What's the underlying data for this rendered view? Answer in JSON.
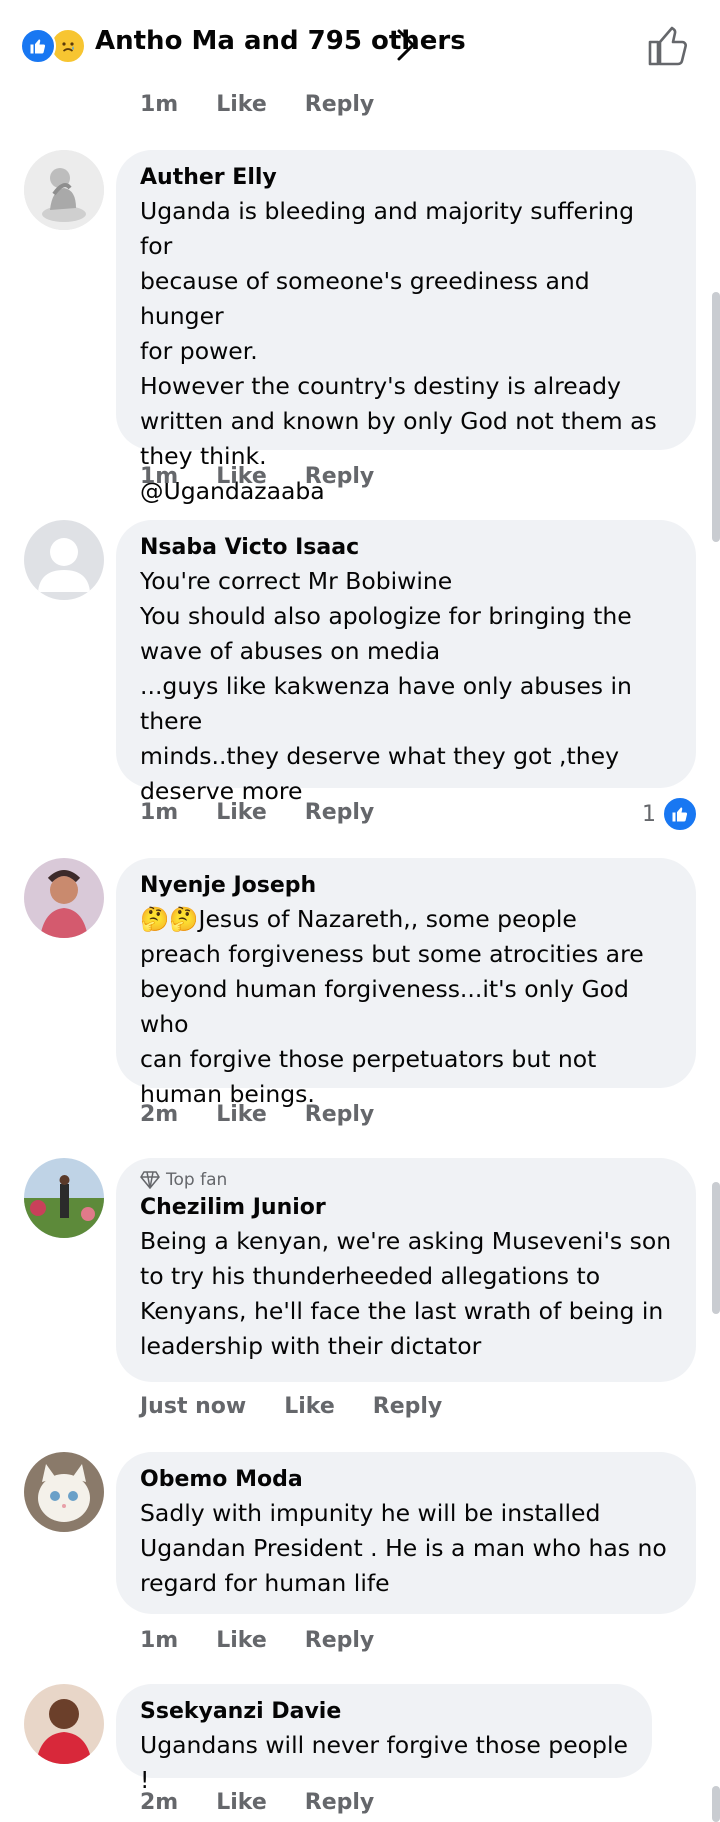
{
  "header": {
    "reactions": [
      "like",
      "sad"
    ],
    "names": "Antho Ma and 795 others"
  },
  "top_actions": {
    "time": "1m",
    "like": "Like",
    "reply": "Reply"
  },
  "comments": [
    {
      "name": "Auther Elly",
      "text": "Uganda is bleeding and majority suffering for\nbecause of someone's greediness and hunger\nfor power.\nHowever the country's destiny is already\nwritten and known by only God not them as\nthey think.\n@Ugandazaaba",
      "time": "1m",
      "like": "Like",
      "reply": "Reply"
    },
    {
      "name": "Nsaba Victo Isaac",
      "text": "You're correct Mr Bobiwine\nYou should also apologize for bringing the\nwave of abuses on media\n...guys like kakwenza have only abuses in there\nminds..they deserve what they got ,they\ndeserve more",
      "time": "1m",
      "like": "Like",
      "reply": "Reply",
      "reaction_count": "1"
    },
    {
      "name": "Nyenje Joseph",
      "text": "🤔🤔Jesus of Nazareth,, some people\npreach forgiveness but some atrocities are\nbeyond human forgiveness...it's only God who\ncan forgive those perpetuators but not\nhuman beings.",
      "time": "2m",
      "like": "Like",
      "reply": "Reply"
    },
    {
      "badge": "Top fan",
      "name": "Chezilim Junior",
      "text": "Being a kenyan, we're asking Museveni's son\nto try his thunderheeded allegations to\nKenyans, he'll face the last wrath of being in\nleadership with their dictator",
      "time": "Just now",
      "like": "Like",
      "reply": "Reply"
    },
    {
      "name": "Obemo Moda",
      "text": "Sadly with impunity he will be installed\nUgandan President . He is a man who has no\nregard for human life",
      "time": "1m",
      "like": "Like",
      "reply": "Reply"
    },
    {
      "name": "Ssekyanzi Davie",
      "text": "Ugandans will never forgive those people !",
      "time": "2m",
      "like": "Like",
      "reply": "Reply"
    }
  ],
  "colors": {
    "accent": "#1877f2",
    "bubble": "#f0f2f5",
    "muted": "#65676b"
  }
}
